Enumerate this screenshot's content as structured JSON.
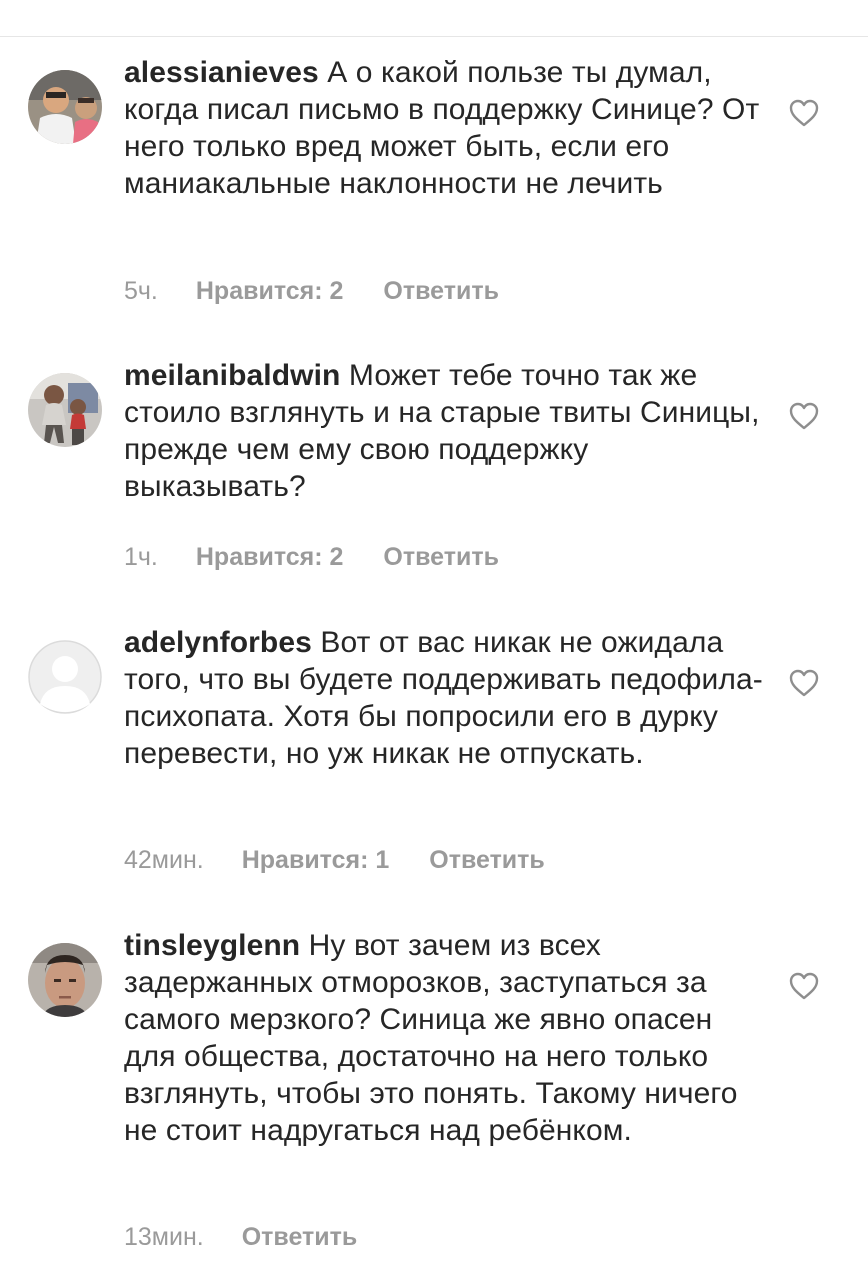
{
  "comments": [
    {
      "username": "alessianieves",
      "text": "А о какой пользе ты думал, когда писал письмо в поддержку Синице? От него только вред может быть, если его маниакальные наклонности не лечить",
      "time": "5ч.",
      "likes": "Нравится: 2",
      "reply": "Ответить",
      "avatar_icon": "profile-photo-icon",
      "like_icon": "heart-outline-icon"
    },
    {
      "username": "meilanibaldwin",
      "text": "Может тебе точно так же стоило взглянуть и на старые твиты Синицы, прежде чем ему свою поддержку выказывать?",
      "time": "1ч.",
      "likes": "Нравится: 2",
      "reply": "Ответить",
      "avatar_icon": "profile-photo-icon",
      "like_icon": "heart-outline-icon"
    },
    {
      "username": "adelynforbes",
      "text": "Вот от вас никак не ожидала того, что вы будете поддерживать педофила-психопата. Хотя бы попросили его в дурку перевести, но уж никак не отпускать.",
      "time": "42мин.",
      "likes": "Нравится: 1",
      "reply": "Ответить",
      "avatar_icon": "default-avatar-icon",
      "like_icon": "heart-outline-icon"
    },
    {
      "username": "tinsleyglenn",
      "text": "Ну вот зачем из всех задержанных отморозков, заступаться за самого мерзкого? Синица же явно опасен для общества, достаточно на него только взглянуть, чтобы это понять. Такому ничего не стоит надругаться над ребёнком.",
      "time": "13мин.",
      "reply": "Ответить",
      "avatar_icon": "profile-photo-icon",
      "like_icon": "heart-outline-icon"
    }
  ],
  "colors": {
    "text": "#262626",
    "meta": "#9a9a9a",
    "divider": "#e6e6e6",
    "background": "#ffffff"
  }
}
